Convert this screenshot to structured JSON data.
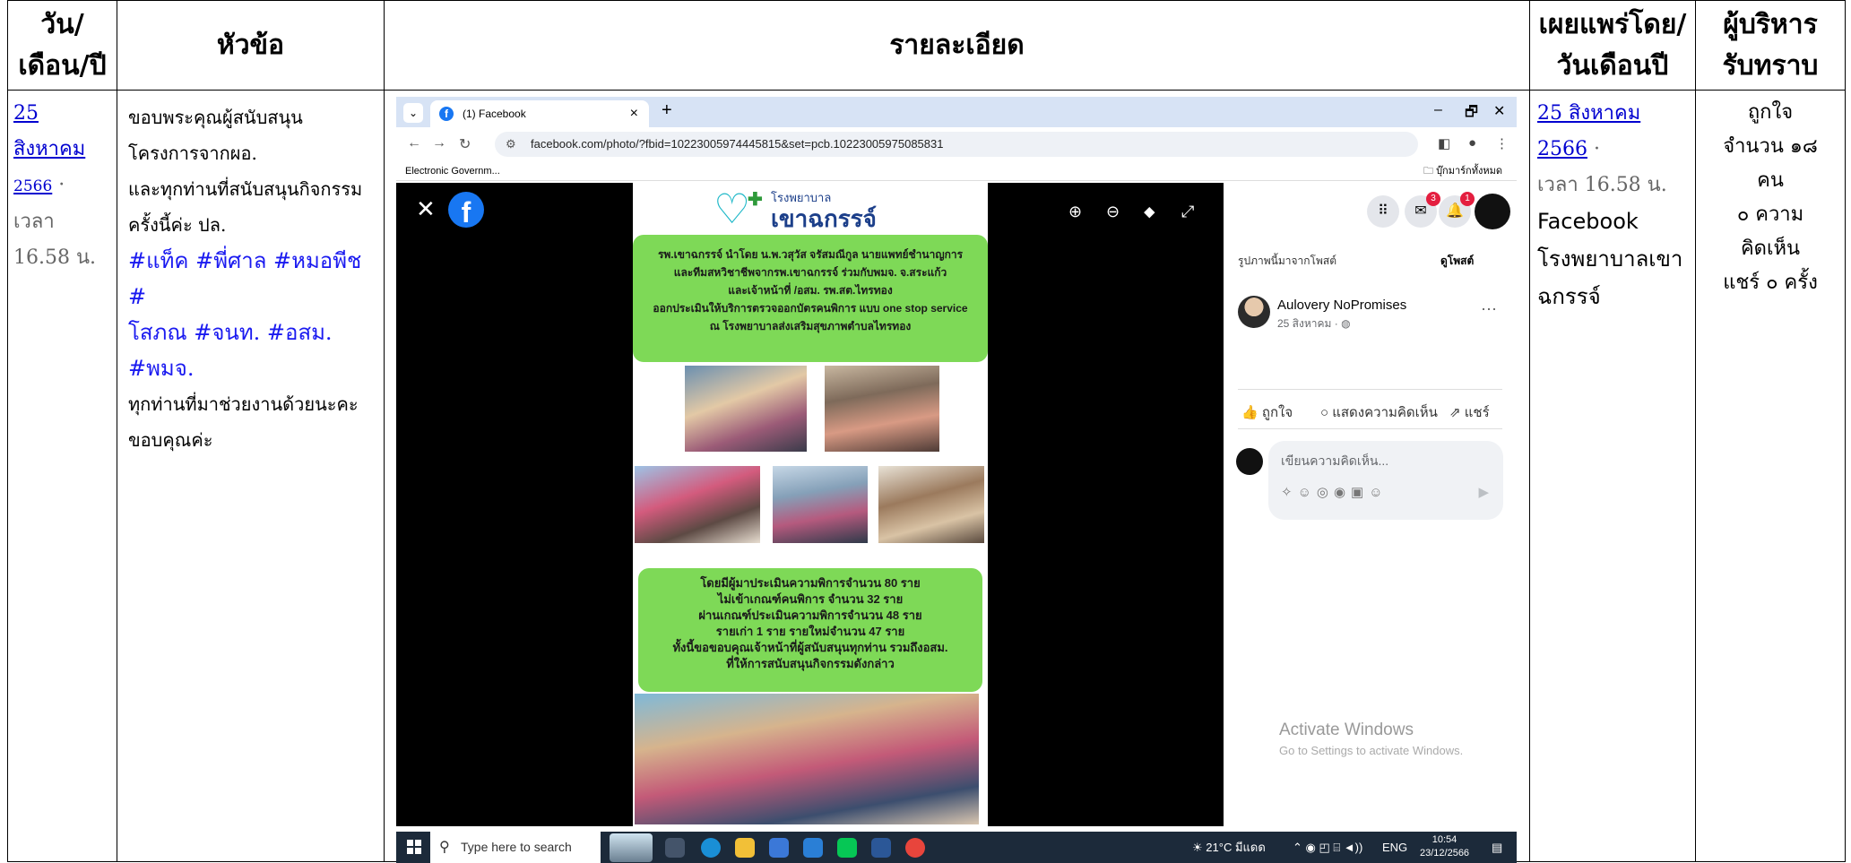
{
  "headers": {
    "date_line1": "วัน/",
    "date_line2": "เดือน/ปี",
    "topic": "หัวข้อ",
    "detail": "รายละเอียด",
    "published_line1": "เผยแพร่โดย/",
    "published_line2": "วันเดือนปี",
    "ack_line1": "ผู้บริหาร",
    "ack_line2": "รับทราบ"
  },
  "row": {
    "date": {
      "link_day": "25 สิงหาคม",
      "link_year": "2566",
      "dot": "·",
      "time_label": "เวลา",
      "time": "16.58 น."
    },
    "topic": {
      "line1": "ขอบพระคุณผู้สนับสนุน",
      "line2": "โครงการจากผอ.",
      "line3": "และทุกท่านที่สนับสนุนกิจกรรม",
      "line4": "ครั้งนี้ค่ะ ปล.",
      "hashtags_line1": "#แท็ค #พี่ศาล #หมอพีช #",
      "hashtags_line2_a": "โสภณ #จนท.",
      "hashtags_line2_b": "#อสม.",
      "hashtags_line2_c": "#พมจ.",
      "line6": "ทุกท่านที่มาช่วยงานด้วยนะคะ",
      "line7": "ขอบคุณค่ะ"
    },
    "published": {
      "link_date": "25 สิงหาคม 2566",
      "dot": "·",
      "time": "เวลา 16.58 น.",
      "platform": "Facebook",
      "page_line1": "โรงพยาบาลเขา",
      "page_line2": "ฉกรรจ์"
    },
    "ack": {
      "line1": "ถูกใจ",
      "line2": "จำนวน ๑๘",
      "line3": "คน",
      "line4": "๐ ความ",
      "line5": "คิดเห็น",
      "line6": "แชร์ ๐ ครั้ง"
    }
  },
  "screenshot": {
    "tab_title": "(1) Facebook",
    "tab_close": "×",
    "new_tab": "+",
    "window_min": "–",
    "window_max": "🗗",
    "window_close": "✕",
    "url": "facebook.com/photo/?fbid=10223005974445815&set=pcb.10223005975085831",
    "bookmark": "Electronic Governm...",
    "all_bookmarks": "บุ๊กมาร์กทั้งหมด",
    "poster": {
      "hospital_small": "โรงพยาบาล",
      "hospital_big": "เขาฉกรรจ์",
      "box1": [
        "รพ.เขาฉกรรจ์ นำโดย น.พ.วสุวัส จรัสมณีกูล นายแพทย์ชำนาญการ",
        "และทีมสหวิชาชีพจากรพ.เขาฉกรรจ์ ร่วมกับพมจ. จ.สระแก้ว",
        "และเจ้าหน้าที่ /อสม. รพ.สต.ไทรทอง",
        "ออกประเมินให้บริการตรวจออกบัตรคนพิการ แบบ one stop service",
        "ณ โรงพยาบาลส่งเสริมสุขภาพตำบลไทรทอง"
      ],
      "box2": [
        "โดยมีผู้มาประเมินความพิการจำนวน 80 ราย",
        "ไม่เข้าเกณฑ์คนพิการ จำนวน 32 ราย",
        "ผ่านเกณฑ์ประเมินความพิการจำนวน 48 ราย",
        "รายเก่า 1 ราย รายใหม่จำนวน 47 ราย",
        "ทั้งนี้ขอขอบคุณเจ้าหน้าที่ผู้สนับสนุนทุกท่าน รวมถึงอสม.",
        "ที่ให้การสนับสนุนกิจกรรมดังกล่าว"
      ]
    },
    "side": {
      "from_post": "รูปภาพนี้มาจากโพสต์",
      "view_post": "ดูโพสต์",
      "author": "Aulovery NoPromises",
      "post_date": "25 สิงหาคม · ◍",
      "more": "···",
      "like": "ถูกใจ",
      "comment": "แสดงความคิดเห็น",
      "share": "แชร์",
      "comment_placeholder": "เขียนความคิดเห็น...",
      "badge_messenger": "3",
      "badge_notif": "1",
      "activate_title": "Activate Windows",
      "activate_sub": "Go to Settings to activate Windows."
    },
    "taskbar": {
      "search_placeholder": "Type here to search",
      "weather": "21°C มีแดด",
      "lang": "ENG",
      "time": "10:54",
      "date": "23/12/2566"
    }
  }
}
